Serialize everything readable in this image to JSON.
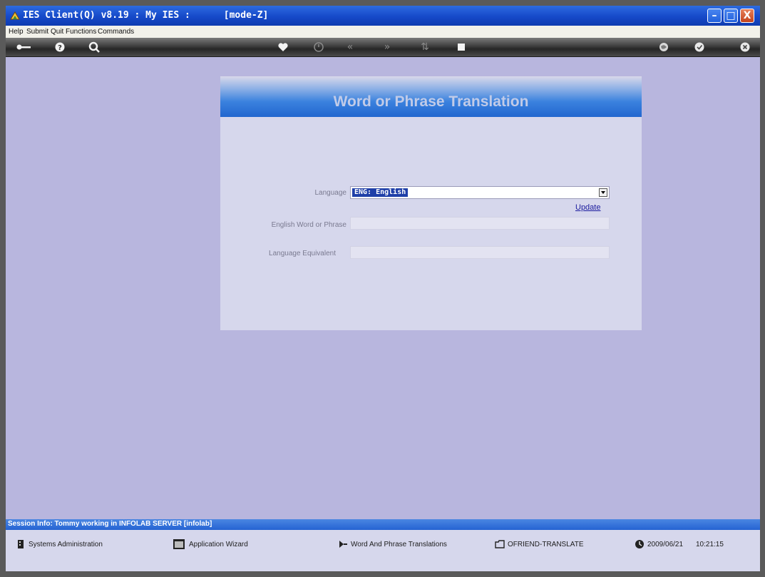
{
  "window": {
    "title": "IES Client(Q) v8.19 : My IES :      [mode-Z]",
    "min_glyph": "–",
    "max_glyph": "□",
    "close_glyph": "X"
  },
  "menu": [
    "Help",
    "Submit",
    "Quit",
    "Functions",
    "Commands"
  ],
  "toolbar": {
    "icons": [
      "key-icon",
      "help-icon",
      "search-icon",
      "heart-icon",
      "clock-icon",
      "rewind-icon",
      "forward-icon",
      "sort-icon",
      "stop-icon",
      "globe-icon",
      "check-icon",
      "close-icon"
    ]
  },
  "form": {
    "title": "Word or Phrase Translation",
    "language_label": "Language",
    "language_value": "ENG: English",
    "english_label": "English Word or Phrase",
    "english_value": "",
    "equivalent_label": "Language Equivalent",
    "equivalent_value": "",
    "update_label": "Update"
  },
  "session": {
    "info": "Session Info: Tommy working in INFOLAB SERVER  [infolab]"
  },
  "taskbar": {
    "items": [
      "Systems Administration",
      "Application Wizard",
      "Word And Phrase Translations",
      "OFRIEND-TRANSLATE"
    ],
    "date": "2009/06/21",
    "time": "10:21:15"
  }
}
